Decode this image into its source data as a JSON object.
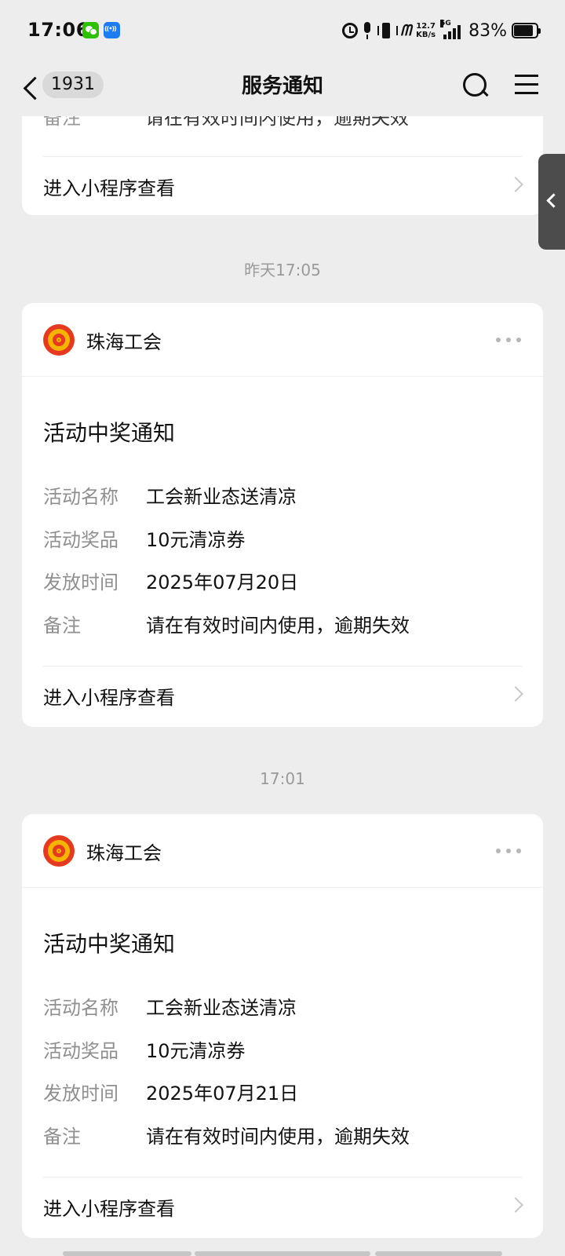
{
  "status_bar": {
    "time": "17:06",
    "network_speed_value": "12.7",
    "network_speed_unit": "KB/s",
    "signal_label": "5G",
    "battery": "83%",
    "icons": [
      "wechat-icon",
      "nfc-icon",
      "alarm-icon",
      "mic-icon",
      "vibrate-icon",
      "signal-icon",
      "battery-icon"
    ]
  },
  "nav": {
    "back_badge": "1931",
    "title": "服务通知"
  },
  "partial_card": {
    "field": "备注",
    "value": "请在有效时间内使用，逾期失效",
    "link": "进入小程序查看"
  },
  "messages": [
    {
      "timestamp": "昨天17:05",
      "org": "珠海工会",
      "title": "活动中奖通知",
      "fields": [
        {
          "label": "活动名称",
          "value": "工会新业态送清凉"
        },
        {
          "label": "活动奖品",
          "value": "10元清凉券"
        },
        {
          "label": "发放时间",
          "value": "2025年07月20日"
        },
        {
          "label": "备注",
          "value": "请在有效时间内使用，逾期失效"
        }
      ],
      "link": "进入小程序查看"
    },
    {
      "timestamp": "17:01",
      "org": "珠海工会",
      "title": "活动中奖通知",
      "fields": [
        {
          "label": "活动名称",
          "value": "工会新业态送清凉"
        },
        {
          "label": "活动奖品",
          "value": "10元清凉券"
        },
        {
          "label": "发放时间",
          "value": "2025年07月21日"
        },
        {
          "label": "备注",
          "value": "请在有效时间内使用，逾期失效"
        }
      ],
      "link": "进入小程序查看"
    }
  ],
  "colors": {
    "background": "#ededed",
    "card": "#ffffff",
    "logo_red": "#e53a1f",
    "logo_gold": "#f5b400"
  }
}
